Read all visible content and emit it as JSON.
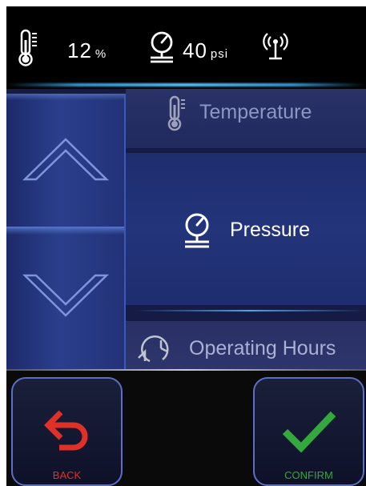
{
  "status_bar": {
    "humidity_value": "12",
    "humidity_unit": "%",
    "pressure_value": "40",
    "pressure_unit": "psi",
    "icons": [
      "thermometer-icon",
      "pressure-gauge-icon",
      "wireless-signal-icon"
    ]
  },
  "menu": {
    "items": [
      {
        "label": "Temperature",
        "icon": "thermometer-icon"
      },
      {
        "label": "Pressure",
        "icon": "pressure-gauge-icon",
        "selected": true
      },
      {
        "label": "Operating Hours",
        "icon": "clock-icon"
      }
    ]
  },
  "buttons": {
    "back_label": "BACK",
    "confirm_label": "CONFIRM"
  },
  "colors": {
    "back": "#e0302a",
    "confirm": "#33a83c",
    "accent": "#5b6fc8"
  }
}
